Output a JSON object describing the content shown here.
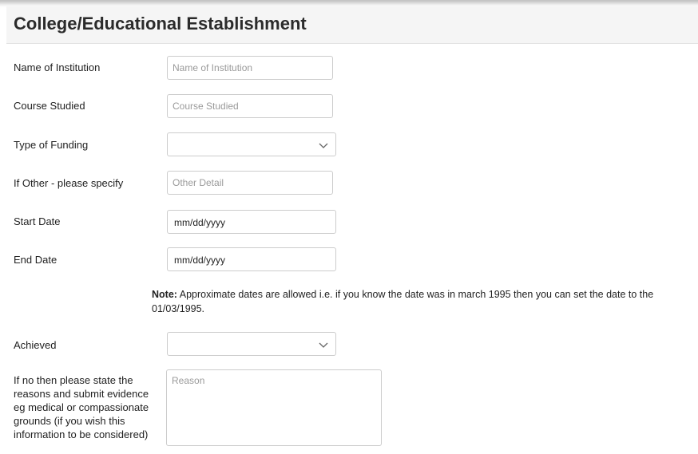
{
  "panel": {
    "title": "College/Educational Establishment"
  },
  "fields": {
    "institution": {
      "label": "Name of Institution",
      "placeholder": "Name of Institution",
      "value": ""
    },
    "course": {
      "label": "Course Studied",
      "placeholder": "Course Studied",
      "value": ""
    },
    "funding": {
      "label": "Type of Funding",
      "selected": ""
    },
    "other": {
      "label": "If Other - please specify",
      "placeholder": "Other Detail",
      "value": ""
    },
    "start_date": {
      "label": "Start Date",
      "display": "mm/dd/yyyy"
    },
    "end_date": {
      "label": "End Date",
      "display": "mm/dd/yyyy"
    },
    "achieved": {
      "label": "Achieved",
      "selected": ""
    },
    "reason": {
      "label": "If no then please state the reasons and submit evidence eg medical or compassionate grounds (if you wish this information to be considered)",
      "placeholder": "Reason",
      "value": ""
    }
  },
  "note": {
    "prefix": "Note:",
    "text": " Approximate dates are allowed i.e. if you know the date was in march 1995 then you can set the date to the 01/03/1995."
  },
  "icons": {
    "dropdown": "chevron-down-icon"
  }
}
